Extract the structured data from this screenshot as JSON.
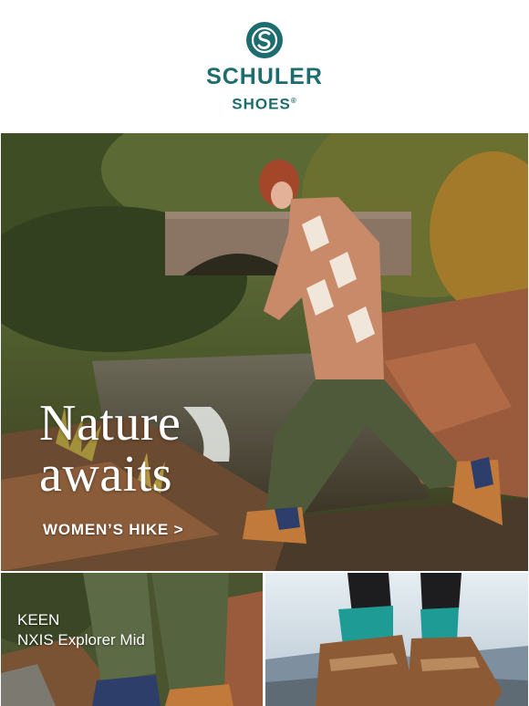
{
  "header": {
    "brand_name": "SCHULER",
    "brand_sub": "SHOES",
    "registered_mark": "®",
    "logo_icon": "s-monogram-icon",
    "brand_color": "#1d6d6f"
  },
  "hero": {
    "title_line1": "Nature",
    "title_line2": "awaits",
    "cta_label": "WOMEN’S HIKE >"
  },
  "tiles": [
    {
      "brand": "KEEN",
      "model": "NXIS Explorer Mid"
    },
    {
      "brand": "",
      "model": ""
    }
  ]
}
